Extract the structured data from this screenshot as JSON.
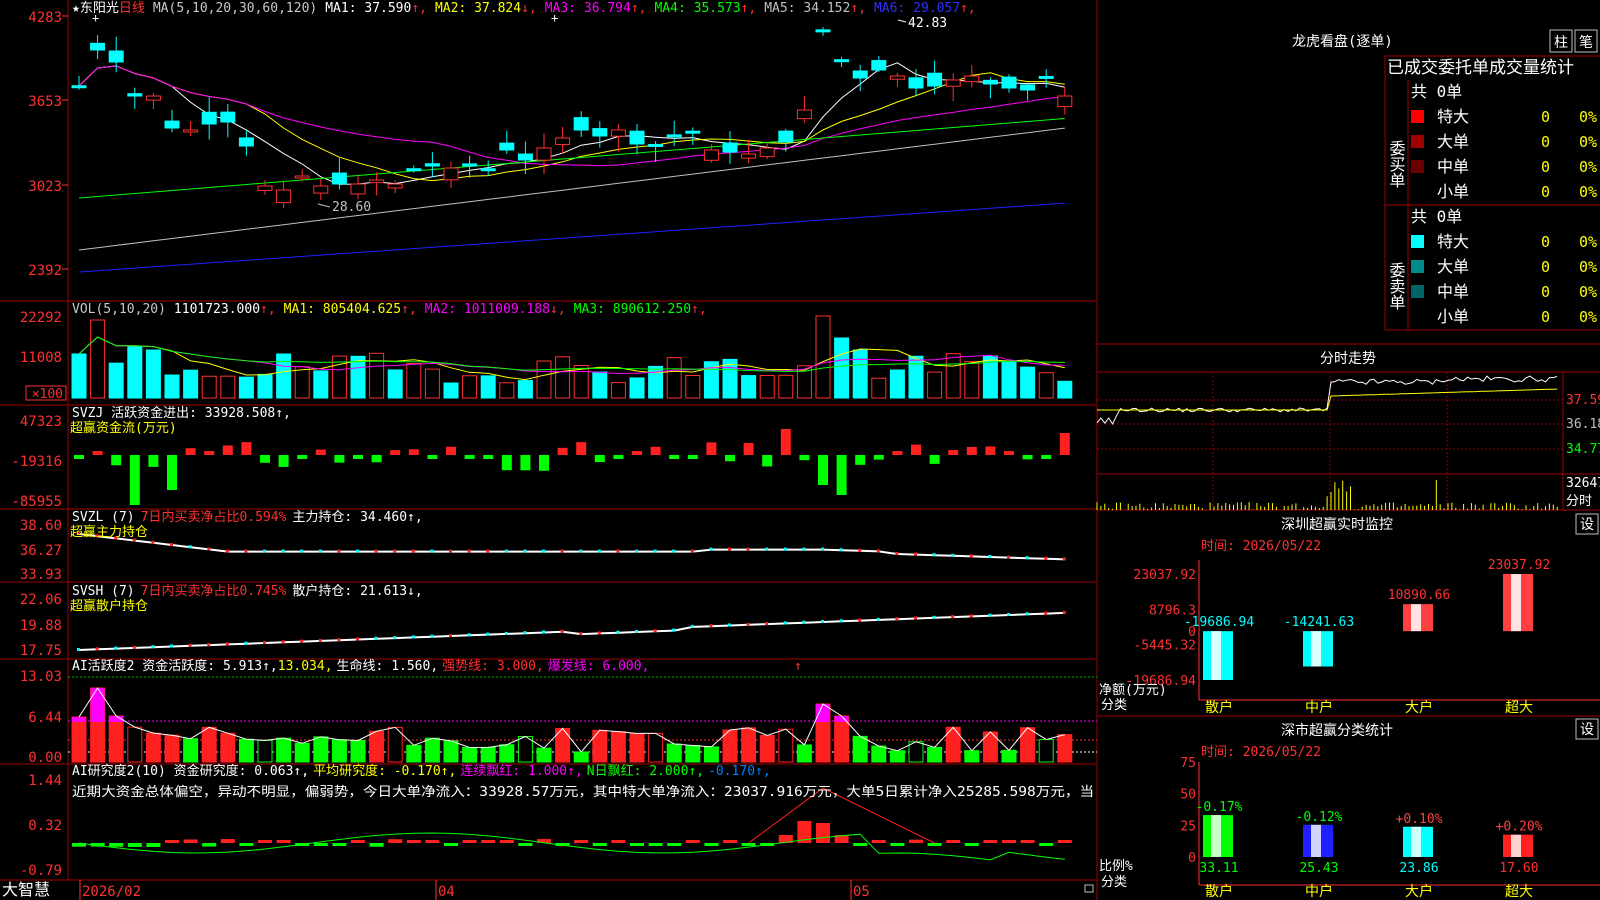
{
  "stock": {
    "name": "东阳光",
    "period": "日线",
    "ma_header": "MA(5,10,20,30,60,120)",
    "ma": [
      {
        "label": "MA1:",
        "value": "37.590",
        "arrow": "↑",
        "color": "#ffffff"
      },
      {
        "label": "MA2:",
        "value": "37.824",
        "arrow": "↓",
        "color": "#ffff00"
      },
      {
        "label": "MA3:",
        "value": "36.794",
        "arrow": "↑",
        "color": "#ff00ff"
      },
      {
        "label": "MA4:",
        "value": "35.573",
        "arrow": "↑",
        "color": "#00ff00"
      },
      {
        "label": "MA5:",
        "value": "34.152",
        "arrow": "↑",
        "color": "#c0c0c0"
      },
      {
        "label": "MA6:",
        "value": "29.057",
        "arrow": "↑",
        "color": "#3030ff"
      }
    ],
    "high_label": "42.83",
    "low_label": "28.60",
    "y_labels": [
      "4283",
      "3653",
      "3023",
      "2392"
    ]
  },
  "vol": {
    "header": "VOL(5,10,20)",
    "value": "1101723.000",
    "items": [
      {
        "label": "MA1:",
        "value": "805404.625",
        "arrow": "↑",
        "color": "#ffff00"
      },
      {
        "label": "MA2:",
        "value": "1011009.188",
        "arrow": "↓",
        "color": "#ff00ff"
      },
      {
        "label": "MA3:",
        "value": "890612.250",
        "arrow": "↑",
        "color": "#00ff00"
      }
    ],
    "y_labels": [
      "22292",
      "11008",
      "×100"
    ]
  },
  "svzj": {
    "line1": "SVZJ  活跃资金进出: 33928.508↑,",
    "line2": "超赢资金流(万元)",
    "y_labels": [
      "47323",
      "-19316",
      "-85955"
    ]
  },
  "svzl": {
    "prefix": "SVZL (7)",
    "red": "7日内买卖净占比0.594%",
    "tail": "主力持仓: 34.460↑,",
    "line2": "超赢主力持仓",
    "y_labels": [
      "38.60",
      "36.27",
      "33.93"
    ]
  },
  "svsh": {
    "prefix": "SVSH (7)",
    "red": "7日内买卖净占比0.745%",
    "tail": "散户持仓: 21.613↓,",
    "line2": "超赢散户持仓",
    "y_labels": [
      "22.06",
      "19.88",
      "17.75"
    ]
  },
  "ai1": {
    "a": "AI活跃度2 资金活跃度: 5.913↑,",
    "b": "13.034,",
    "c": "生命线: 1.560,",
    "d": "强势线: 3.000,",
    "e": "爆发线: 6.000,",
    "y_labels": [
      "13.03",
      "6.44",
      "0.00"
    ]
  },
  "ai2": {
    "a": "AI研究度2(10) 资金研究度: 0.063↑,",
    "b": "平均研究度: -0.170↑,",
    "c": "连续飘红: 1.000↑,",
    "d": "N日飘红: 2.000↑,",
    "e": "-0.170↑,",
    "text": "近期大资金总体偏空，异动不明显，偏弱势，今日大单净流入：33928.57万元，其中特大单净流入：23037.916万元，大单5日累计净入25285.598万元，当",
    "y_labels": [
      "1.44",
      "0.32",
      "-0.79"
    ]
  },
  "xaxis": {
    "labels": [
      "2026/02",
      "04",
      "05"
    ]
  },
  "footer": {
    "app": "大智慧"
  },
  "longhu": {
    "title": "龙虎看盘(逐单)",
    "btn1": "柱",
    "btn2": "笔",
    "header": "已成交委托单成交量统计",
    "buy_label": "委买单",
    "sell_label": "委卖单",
    "buy_total": "共 0单",
    "sell_total": "共 0单",
    "buy_rows": [
      {
        "name": "特大",
        "val": "0",
        "pct": "0%",
        "color": "#ff0000"
      },
      {
        "name": "大单",
        "val": "0",
        "pct": "0%",
        "color": "#a00000"
      },
      {
        "name": "中单",
        "val": "0",
        "pct": "0%",
        "color": "#6a0000"
      },
      {
        "name": "小单",
        "val": "0",
        "pct": "0%",
        "color": ""
      }
    ],
    "sell_rows": [
      {
        "name": "特大",
        "val": "0",
        "pct": "0%",
        "color": "#00ffff"
      },
      {
        "name": "大单",
        "val": "0",
        "pct": "0%",
        "color": "#008a8a"
      },
      {
        "name": "中单",
        "val": "0",
        "pct": "0%",
        "color": "#006464"
      },
      {
        "name": "小单",
        "val": "0",
        "pct": "0%",
        "color": ""
      }
    ]
  },
  "intraday": {
    "title": "分时走势",
    "y_labels": [
      "37.59",
      "36.18",
      "34.77",
      "32647"
    ],
    "footer": "分时"
  },
  "monitor": {
    "title": "深圳超赢实时监控",
    "time": "时间: 2026/05/22",
    "btn": "设",
    "y_labels": [
      "23037.92",
      "8796.3",
      "0",
      "-5445.32",
      "-19686.94"
    ],
    "axis_name1": "净额(万元)",
    "axis_name2": "分类",
    "bars": [
      {
        "cat": "散户",
        "value": -19686.94,
        "label": "-19686.94",
        "color": "#00ffff"
      },
      {
        "cat": "中户",
        "value": -14241.63,
        "label": "-14241.63",
        "color": "#00ffff"
      },
      {
        "cat": "大户",
        "value": 10890.66,
        "label": "10890.66",
        "color": "#ff4040"
      },
      {
        "cat": "超大",
        "value": 23037.92,
        "label": "23037.92",
        "color": "#ff4040"
      }
    ]
  },
  "stats": {
    "title": "深市超赢分类统计",
    "time": "时间: 2026/05/22",
    "btn": "设",
    "y_labels": [
      "75",
      "50",
      "25",
      "0"
    ],
    "axis_name1": "比例%",
    "axis_name2": "分类",
    "bars": [
      {
        "cat": "散户",
        "value": 33.11,
        "label": "33.11",
        "change": "-0.17%",
        "change_color": "#00ff00",
        "bar_color": "#00ff00"
      },
      {
        "cat": "中户",
        "value": 25.43,
        "label": "25.43",
        "change": "-0.12%",
        "change_color": "#00ff00",
        "bar_color": "#2020ff"
      },
      {
        "cat": "大户",
        "value": 23.86,
        "label": "23.86",
        "change": "+0.10%",
        "change_color": "#ff4040",
        "bar_color": "#00ffff"
      },
      {
        "cat": "超大",
        "value": 17.6,
        "label": "17.60",
        "change": "+0.20%",
        "change_color": "#ff4040",
        "bar_color": "#ff2020"
      }
    ]
  }
}
